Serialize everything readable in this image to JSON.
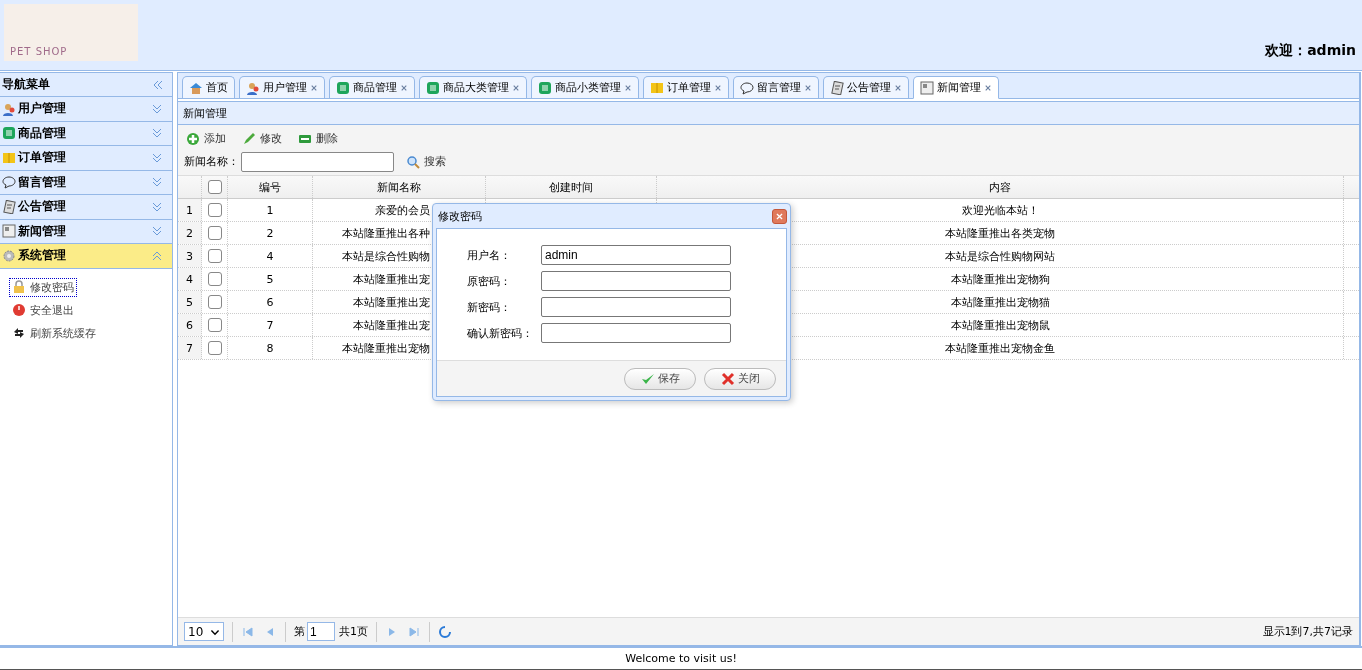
{
  "header": {
    "logo_text": "PET SHOP",
    "welcome_label": "欢迎：",
    "welcome_user": "admin"
  },
  "sidebar": {
    "title": "导航菜单",
    "items": [
      {
        "label": "用户管理",
        "kind": "users",
        "expanded": false
      },
      {
        "label": "商品管理",
        "kind": "list",
        "expanded": false
      },
      {
        "label": "订单管理",
        "kind": "book",
        "expanded": false
      },
      {
        "label": "留言管理",
        "kind": "bubble",
        "expanded": false
      },
      {
        "label": "公告管理",
        "kind": "note",
        "expanded": false
      },
      {
        "label": "新闻管理",
        "kind": "news",
        "expanded": false
      },
      {
        "label": "系统管理",
        "kind": "gear",
        "expanded": true,
        "children": [
          {
            "label": "修改密码",
            "kind": "lock",
            "selected": true
          },
          {
            "label": "安全退出",
            "kind": "power",
            "selected": false
          },
          {
            "label": "刷新系统缓存",
            "kind": "refresh",
            "selected": false
          }
        ]
      }
    ]
  },
  "tabs": [
    {
      "label": "首页",
      "kind": "home",
      "closable": false,
      "selected": false
    },
    {
      "label": "用户管理",
      "kind": "users",
      "closable": true,
      "selected": false
    },
    {
      "label": "商品管理",
      "kind": "list",
      "closable": true,
      "selected": false
    },
    {
      "label": "商品大类管理",
      "kind": "list",
      "closable": true,
      "selected": false
    },
    {
      "label": "商品小类管理",
      "kind": "list",
      "closable": true,
      "selected": false
    },
    {
      "label": "订单管理",
      "kind": "book",
      "closable": true,
      "selected": false
    },
    {
      "label": "留言管理",
      "kind": "bubble",
      "closable": true,
      "selected": false
    },
    {
      "label": "公告管理",
      "kind": "note",
      "closable": true,
      "selected": false
    },
    {
      "label": "新闻管理",
      "kind": "news",
      "closable": true,
      "selected": true
    }
  ],
  "panel": {
    "title": "新闻管理",
    "toolbar": [
      {
        "label": "添加",
        "kind": "add"
      },
      {
        "label": "修改",
        "kind": "edit"
      },
      {
        "label": "删除",
        "kind": "remove"
      }
    ],
    "search": {
      "label": "新闻名称：",
      "button": "搜索"
    },
    "table": {
      "columns": [
        "编号",
        "新闻名称",
        "创建时间",
        "内容"
      ],
      "all_checked": false,
      "rows": [
        {
          "index": "1",
          "checked": false,
          "id": "1",
          "name": "亲爱的会员",
          "content": "欢迎光临本站！"
        },
        {
          "index": "2",
          "checked": false,
          "id": "2",
          "name": "本站隆重推出各种",
          "content": "本站隆重推出各类宠物"
        },
        {
          "index": "3",
          "checked": false,
          "id": "4",
          "name": "本站是综合性购物",
          "content": "本站是综合性购物网站"
        },
        {
          "index": "4",
          "checked": false,
          "id": "5",
          "name": "本站隆重推出宠",
          "content": "本站隆重推出宠物狗"
        },
        {
          "index": "5",
          "checked": false,
          "id": "6",
          "name": "本站隆重推出宠",
          "content": "本站隆重推出宠物猫"
        },
        {
          "index": "6",
          "checked": false,
          "id": "7",
          "name": "本站隆重推出宠",
          "content": "本站隆重推出宠物鼠"
        },
        {
          "index": "7",
          "checked": false,
          "id": "8",
          "name": "本站隆重推出宠物",
          "content": "本站隆重推出宠物金鱼"
        }
      ]
    },
    "pager": {
      "page_size": "10",
      "page_prefix": "第",
      "page": "1",
      "page_total": "共1页",
      "summary": "显示1到7,共7记录"
    }
  },
  "dialog": {
    "title": "修改密码",
    "fields": [
      {
        "label": "用户名：",
        "value": "admin"
      },
      {
        "label": "原密码："
      },
      {
        "label": "新密码："
      },
      {
        "label": "确认新密码："
      }
    ],
    "buttons": [
      {
        "label": "保存",
        "kind": "save"
      },
      {
        "label": "关闭",
        "kind": "close"
      }
    ]
  },
  "footer": {
    "text": "Welcome to visit us!"
  }
}
